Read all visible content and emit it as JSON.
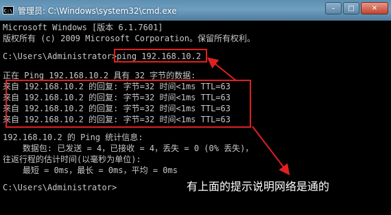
{
  "window": {
    "title": "管理员: C:\\Windows\\system32\\cmd.exe",
    "icon": "cmd-icon",
    "icon_text": "C:\\",
    "controls": {
      "minimize": "–",
      "maximize": "□",
      "close": "✕"
    }
  },
  "console": {
    "lines": [
      "Microsoft Windows [版本 6.1.7601]",
      "版权所有 (c) 2009 Microsoft Corporation。保留所有权利。",
      "",
      "C:\\Users\\Administrator>ping 192.168.10.2",
      "",
      "正在 Ping 192.168.10.2 具有 32 字节的数据:",
      "来自 192.168.10.2 的回复: 字节=32 时间<1ms TTL=63",
      "来自 192.168.10.2 的回复: 字节=32 时间<1ms TTL=63",
      "来自 192.168.10.2 的回复: 字节=32 时间<1ms TTL=63",
      "来自 192.168.10.2 的回复: 字节=32 时间<1ms TTL=63",
      "",
      "192.168.10.2 的 Ping 统计信息:",
      "    数据包: 已发送 = 4，已接收 = 4，丢失 = 0 (0% 丢失)，",
      "往返行程的估计时间(以毫秒为单位):",
      "    最短 = 0ms，最长 = 0ms，平均 = 0ms",
      "",
      "C:\\Users\\Administrator>"
    ]
  },
  "annotation": {
    "text": "有上面的提示说明网络是通的",
    "color": "#ffffff",
    "highlight_color": "#e02020"
  }
}
